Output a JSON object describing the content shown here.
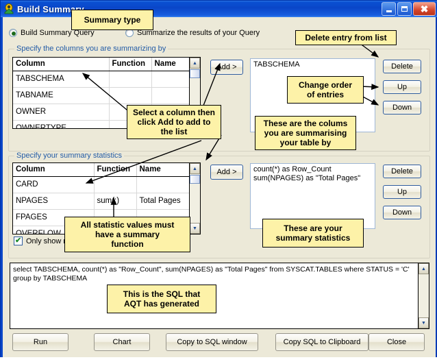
{
  "window": {
    "title": "Build Summary",
    "icon": "app-icon",
    "buttons": {
      "minimize": "minimize-icon",
      "maximize": "maximize-icon",
      "close": "close-icon"
    }
  },
  "summary_type": {
    "options": [
      {
        "label": "Build Summary Query",
        "selected": true
      },
      {
        "label": "Summarize the results of your Query",
        "selected": false
      }
    ]
  },
  "group_by": {
    "legend": "Specify the columns you are summarizing by",
    "grid": {
      "headers": [
        "Column",
        "Function",
        "Name"
      ],
      "rows": [
        {
          "column": "TABSCHEMA",
          "function": "",
          "name": ""
        },
        {
          "column": "TABNAME",
          "function": "",
          "name": ""
        },
        {
          "column": "OWNER",
          "function": "",
          "name": ""
        },
        {
          "column": "OWNERTYPE",
          "function": "",
          "name": ""
        }
      ]
    },
    "add_button": "Add >",
    "list_items": [
      "TABSCHEMA"
    ],
    "side_buttons": [
      "Delete",
      "Up",
      "Down"
    ]
  },
  "statistics": {
    "legend": "Specify your summary statistics",
    "grid": {
      "headers": [
        "Column",
        "Function",
        "Name"
      ],
      "rows": [
        {
          "column": "CARD",
          "function": "",
          "name": ""
        },
        {
          "column": "NPAGES",
          "function": "sum(:)",
          "name": "Total Pages"
        },
        {
          "column": "FPAGES",
          "function": "",
          "name": ""
        },
        {
          "column": "OVERFLOW",
          "function": "",
          "name": ""
        }
      ]
    },
    "add_button": "Add >",
    "list_items": [
      "count(*) as Row_Count",
      "sum(NPAGES) as \"Total Pages\""
    ],
    "side_buttons": [
      "Delete",
      "Up",
      "Down"
    ],
    "only_show_checkbox": {
      "label": "Only show n",
      "checked": true
    }
  },
  "sql": {
    "text": "select TABSCHEMA, count(*) as \"Row_Count\", sum(NPAGES) as \"Total Pages\" from SYSCAT.TABLES where STATUS = 'C' group by TABSCHEMA"
  },
  "footer": {
    "buttons": [
      "Run",
      "Chart",
      "Copy to SQL window",
      "Copy SQL to Clipboard",
      "Close"
    ]
  },
  "callouts": [
    {
      "id": "summary-type",
      "text": "Summary type"
    },
    {
      "id": "delete-entry",
      "text": "Delete entry from list"
    },
    {
      "id": "change-order",
      "text": "Change order\nof entries"
    },
    {
      "id": "select-column",
      "text": "Select a column then\nclick Add to add to\nthe list"
    },
    {
      "id": "these-columns",
      "text": "These are the colums\nyou are summarising\nyour table by"
    },
    {
      "id": "statistic-values",
      "text": "All statistic values must\nhave a summary\nfunction"
    },
    {
      "id": "summary-stats",
      "text": "These are your\nsummary statistics"
    },
    {
      "id": "generated-sql",
      "text": "This is the SQL that\nAQT has generated"
    }
  ],
  "colors": {
    "titlebar": "#0a46c8",
    "client": "#ece9d8",
    "callout": "#fdf2a8",
    "legend_text": "#225ba6"
  }
}
